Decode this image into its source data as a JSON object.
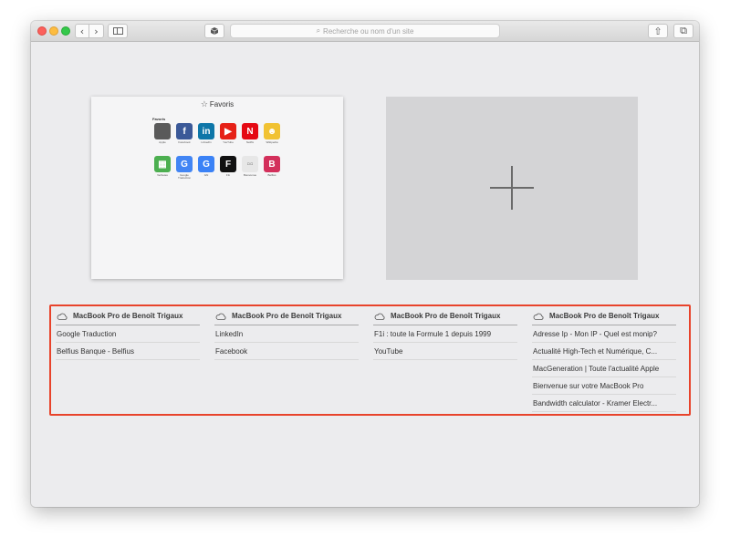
{
  "toolbar": {
    "back_glyph": "‹",
    "forward_glyph": "›",
    "search_placeholder": "Recherche ou nom d'un site",
    "search_icon": "magnifier-icon",
    "share_glyph": "⇧",
    "tabs_glyph": "⧉"
  },
  "favorites_thumbnail": {
    "title": "Favoris",
    "section": "Favoris",
    "right_note": "",
    "tiles": [
      {
        "letter": "",
        "color": "#5a5a5a",
        "label": "Apple"
      },
      {
        "letter": "f",
        "color": "#3b5998",
        "label": "Facebook"
      },
      {
        "letter": "in",
        "color": "#0e76a8",
        "label": "LinkedIn"
      },
      {
        "letter": "▶",
        "color": "#e62117",
        "label": "YouTube"
      },
      {
        "letter": "N",
        "color": "#e50914",
        "label": "Netflix"
      },
      {
        "letter": "☻",
        "color": "#f1c232",
        "label": "Wikipedia"
      },
      {
        "letter": "▦",
        "color": "#4caf50",
        "label": "Verbetes"
      },
      {
        "letter": "G",
        "color": "#4285f4",
        "label": "Google Traduction"
      },
      {
        "letter": "G",
        "color": "#3b82f6",
        "label": "GN"
      },
      {
        "letter": "F",
        "color": "#111111",
        "label": "F1i"
      },
      {
        "letter": "▫▫",
        "color": "#e7e7e7",
        "label": "Bienvenue"
      },
      {
        "letter": "B",
        "color": "#d32f5b",
        "label": "Belfius"
      }
    ]
  },
  "icloud_tabs": {
    "columns": [
      {
        "device": "MacBook Pro de Benoît Trigaux",
        "items": [
          "Google Traduction",
          "Belfius Banque - Belfius"
        ]
      },
      {
        "device": "MacBook Pro de Benoît Trigaux",
        "items": [
          "LinkedIn",
          "Facebook"
        ]
      },
      {
        "device": "MacBook Pro de Benoît Trigaux",
        "items": [
          "F1i : toute la Formule 1 depuis 1999",
          "YouTube"
        ]
      },
      {
        "device": "MacBook Pro de Benoît Trigaux",
        "items": [
          "Adresse Ip - Mon IP - Quel est monip?",
          "Actualité High-Tech et Numérique, C...",
          "MacGeneration | Toute l'actualité Apple",
          "Bienvenue sur votre MacBook Pro",
          "Bandwidth calculator - Kramer Electr..."
        ]
      }
    ]
  },
  "colors": {
    "highlight_border": "#e8432b",
    "new_tab_bg": "#d4d4d6"
  }
}
